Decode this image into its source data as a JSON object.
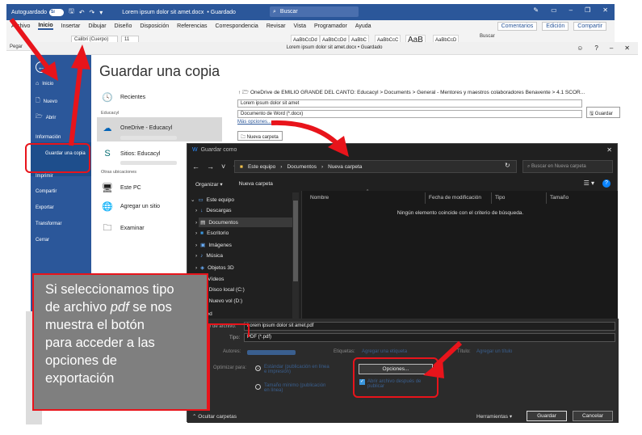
{
  "titlebar": {
    "autosave_label": "Autoguardado",
    "autosave_state": "Sí",
    "doc_title": "Lorem ipsum dolor sit amet.docx",
    "saved_state": "• Guardado",
    "search_placeholder": "Buscar"
  },
  "ribbon": {
    "tabs": [
      "Archivo",
      "Inicio",
      "Insertar",
      "Dibujar",
      "Diseño",
      "Disposición",
      "Referencias",
      "Correspondencia",
      "Revisar",
      "Vista",
      "Programador",
      "Ayuda"
    ],
    "active_tab": "Inicio",
    "comments_label": "Comentarios",
    "edit_label": "Edición",
    "share_label": "Compartir",
    "paste_label": "Pegar",
    "font_name": "Calibri (Cuerpo)",
    "font_size": "11",
    "style_samples": [
      "AaBbCcDd",
      "AaBbCcDd",
      "AaBbC",
      "AaBbCcC",
      "AaB",
      "AaBbCcD"
    ],
    "search_label": "Buscar"
  },
  "backstage": {
    "doc_caption": "Lorem ipsum dolor sit amet.docx",
    "saved_state": "• Guardado",
    "heading": "Guardar una copia",
    "nav": {
      "home": "Inicio",
      "new": "Nuevo",
      "open": "Abrir",
      "info": "Información",
      "save_copy": "Guardar una copia",
      "print": "Imprimir",
      "share": "Compartir",
      "export": "Exportar",
      "transform": "Transformar",
      "close": "Cerrar"
    },
    "locations": {
      "recent": "Recientes",
      "group_org": "Educacyl",
      "onedrive": "OneDrive - Educacyl",
      "sites": "Sitios: Educacyl",
      "group_other": "Otras ubicaciones",
      "this_pc": "Este PC",
      "add_place": "Agregar un sitio",
      "browse": "Examinar"
    },
    "path": "OneDrive de EMILIO GRANDE DEL CANTO: Educacyl > Documents > General - Mentores y maestros colaboradores Benavente > 4.1 SCOR...",
    "filename": "Lorem ipsum dolor sit amet",
    "filetype": "Documento de Word (*.docx)",
    "more_options": "Más opciones...",
    "save_button": "Guardar",
    "new_folder": "Nueva carpeta"
  },
  "dialog": {
    "title": "Guardar como",
    "breadcrumb": [
      "Este equipo",
      "Documentos",
      "Nueva carpeta"
    ],
    "search_placeholder": "Buscar en Nueva carpeta",
    "organize": "Organizar",
    "new_folder": "Nueva carpeta",
    "columns": [
      "Nombre",
      "Fecha de modificación",
      "Tipo",
      "Tamaño"
    ],
    "empty_message": "Ningún elemento coincide con el criterio de búsqueda.",
    "tree": [
      "Este equipo",
      "Descargas",
      "Documentos",
      "Escritorio",
      "Imágenes",
      "Música",
      "Objetos 3D",
      "Vídeos",
      "Disco local (C:)",
      "Nuevo vol (D:)",
      "Red"
    ],
    "filename_label": "Nombre de archivo:",
    "filename_value": "Lorem ipsum dolor sit amet.pdf",
    "type_label": "Tipo:",
    "type_value": "PDF (*.pdf)",
    "authors_label": "Autores:",
    "tags_label": "Etiquetas:",
    "tags_value": "Agregar una etiqueta",
    "title_label": "Título:",
    "title_value": "Agregar un título",
    "optimize_label": "Optimizar para:",
    "optimize_standard": "Estándar (publicación en línea e impresión)",
    "optimize_minimum": "Tamaño mínimo (publicación en línea)",
    "options_button": "Opciones...",
    "open_after": "Abrir archivo después de publicar",
    "hide_folders": "Ocultar carpetas",
    "tools": "Herramientas",
    "save": "Guardar",
    "cancel": "Cancelar"
  },
  "callout": {
    "line1": "Si seleccionamos tipo",
    "line2a": "de archivo ",
    "line2b": "pdf",
    "line2c": " se nos",
    "line3": "muestra el botón",
    "line4": "para acceder a las",
    "line5": "opciones de",
    "line6": "exportación"
  },
  "colors": {
    "word_blue": "#2b579a",
    "annotation_red": "#e8141b",
    "dialog_bg": "#202020",
    "link_blue": "#3a96dd"
  }
}
